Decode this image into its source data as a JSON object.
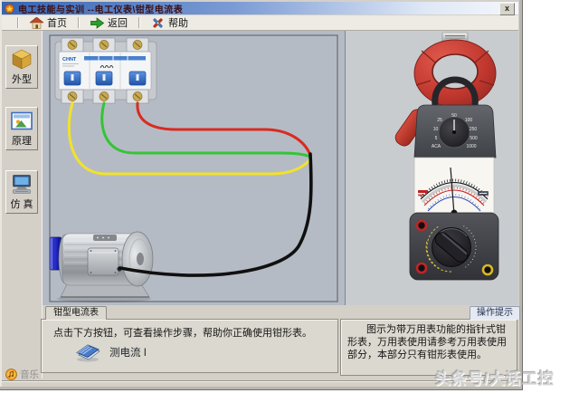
{
  "window": {
    "title": "电工技能与实训 --电工仪表\\钳型电流表",
    "close_glyph": "x"
  },
  "toolbar": {
    "home_label": "首页",
    "back_label": "返回",
    "help_label": "帮助"
  },
  "sidebar": {
    "items": [
      {
        "label": "外型"
      },
      {
        "label": "原理"
      },
      {
        "label": "仿 真"
      }
    ]
  },
  "sim": {
    "breaker_brand": "CHNT",
    "wire_colors": {
      "phase_a": "#d92b20",
      "phase_b": "#35c436",
      "phase_c": "#f2e22a",
      "load": "#101010"
    }
  },
  "meter": {
    "dial_labels": [
      "25",
      "50",
      "100",
      "250",
      "500",
      "1000",
      "10",
      "5",
      "ACA"
    ]
  },
  "panels": {
    "left": {
      "tab": "钳型电流表",
      "instruction": "点击下方按钮，可查看操作步骤，帮助你正确使用钳形表。",
      "button_label": "测电流 I"
    },
    "right": {
      "tab": "操作提示",
      "tip": "图示为带万用表功能的指针式钳形表，万用表使用请参考万用表使用部分，本部分只有钳形表使用。"
    }
  },
  "statusbar": {
    "music_label": "音乐"
  },
  "watermark": {
    "text": "头条号/大话工控"
  }
}
